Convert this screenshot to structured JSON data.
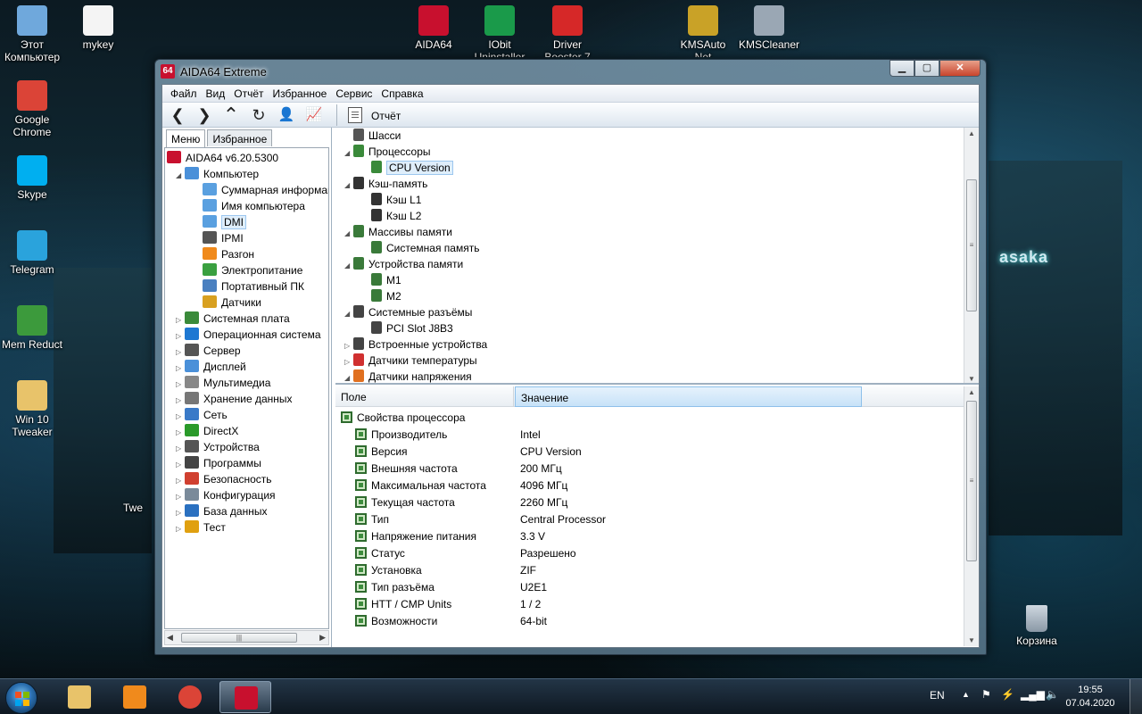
{
  "desktop": {
    "icons_left": [
      {
        "label": "Этот Компьютер",
        "icon": "computer-icon",
        "color": "#6fa8dc"
      },
      {
        "label": "mykey",
        "icon": "file-icon",
        "color": "#f4f4f4"
      },
      {
        "label": "Google Chrome",
        "icon": "chrome-icon",
        "color": "#db4437"
      },
      {
        "label": "Skype",
        "icon": "skype-icon",
        "color": "#00aff0"
      },
      {
        "label": "Telegram",
        "icon": "telegram-icon",
        "color": "#2aa3dc"
      },
      {
        "label": "Mem Reduct",
        "icon": "memreduct-icon",
        "color": "#3c9a3c"
      },
      {
        "label": "Win 10 Tweaker",
        "icon": "folder-icon",
        "color": "#e8c36a"
      }
    ],
    "icons_top": [
      {
        "label": "AIDA64",
        "icon": "aida64-icon",
        "color": "#c8102e"
      },
      {
        "label": "IObit Uninstaller",
        "icon": "iobit-icon",
        "color": "#1a9a4a"
      },
      {
        "label": "Driver Booster 7",
        "icon": "driverbooster-icon",
        "color": "#d62828"
      },
      {
        "label": "KMSAuto Net",
        "icon": "kmsauto-icon",
        "color": "#c9a227"
      },
      {
        "label": "KMSCleaner",
        "icon": "kmscleaner-icon",
        "color": "#9aa7b4"
      }
    ],
    "recycle_bin": {
      "label": "Корзина",
      "icon": "recycle-bin-icon"
    },
    "partial_label": "Twe",
    "sign_text": "asaka"
  },
  "window": {
    "title": "AIDA64 Extreme",
    "app_icon_text": "64",
    "buttons": {
      "minimize": "▁",
      "maximize": "▢",
      "close": "✕"
    },
    "menu": [
      "Файл",
      "Вид",
      "Отчёт",
      "Избранное",
      "Сервис",
      "Справка"
    ],
    "toolbar": {
      "back": "❮",
      "forward": "❯",
      "up": "⌃",
      "refresh": "↻",
      "user": "👤",
      "chart": "📈",
      "report_label": "Отчёт"
    },
    "tabs": [
      "Меню",
      "Избранное"
    ],
    "left_tree": [
      {
        "label": "AIDA64 v6.20.5300",
        "level": 0,
        "exp": "",
        "icon": "aida64-icon",
        "color": "#c8102e"
      },
      {
        "label": "Компьютер",
        "level": 1,
        "exp": "◢",
        "icon": "computer-icon",
        "color": "#4a90d9"
      },
      {
        "label": "Суммарная информация",
        "level": 2,
        "exp": "",
        "icon": "monitor-icon",
        "color": "#5aa0e0"
      },
      {
        "label": "Имя компьютера",
        "level": 2,
        "exp": "",
        "icon": "monitor-icon",
        "color": "#5aa0e0"
      },
      {
        "label": "DMI",
        "level": 2,
        "exp": "",
        "icon": "monitor-icon",
        "color": "#5aa0e0",
        "selected": true
      },
      {
        "label": "IPMI",
        "level": 2,
        "exp": "",
        "icon": "phone-icon",
        "color": "#555"
      },
      {
        "label": "Разгон",
        "level": 2,
        "exp": "",
        "icon": "flame-icon",
        "color": "#f08a1c"
      },
      {
        "label": "Электропитание",
        "level": 2,
        "exp": "",
        "icon": "battery-icon",
        "color": "#3aa040"
      },
      {
        "label": "Портативный ПК",
        "level": 2,
        "exp": "",
        "icon": "laptop-icon",
        "color": "#4a80c0"
      },
      {
        "label": "Датчики",
        "level": 2,
        "exp": "",
        "icon": "sensor-icon",
        "color": "#d8a020"
      },
      {
        "label": "Системная плата",
        "level": 1,
        "exp": "▷",
        "icon": "motherboard-icon",
        "color": "#3a8a3a"
      },
      {
        "label": "Операционная система",
        "level": 1,
        "exp": "▷",
        "icon": "windows-icon",
        "color": "#1e78d2"
      },
      {
        "label": "Сервер",
        "level": 1,
        "exp": "▷",
        "icon": "server-icon",
        "color": "#555"
      },
      {
        "label": "Дисплей",
        "level": 1,
        "exp": "▷",
        "icon": "display-icon",
        "color": "#4a90d9"
      },
      {
        "label": "Мультимедиа",
        "level": 1,
        "exp": "▷",
        "icon": "speaker-icon",
        "color": "#888"
      },
      {
        "label": "Хранение данных",
        "level": 1,
        "exp": "▷",
        "icon": "storage-icon",
        "color": "#777"
      },
      {
        "label": "Сеть",
        "level": 1,
        "exp": "▷",
        "icon": "network-icon",
        "color": "#3a7ac8"
      },
      {
        "label": "DirectX",
        "level": 1,
        "exp": "▷",
        "icon": "xbox-icon",
        "color": "#2a9a2a"
      },
      {
        "label": "Устройства",
        "level": 1,
        "exp": "▷",
        "icon": "device-icon",
        "color": "#555"
      },
      {
        "label": "Программы",
        "level": 1,
        "exp": "▷",
        "icon": "programs-icon",
        "color": "#444"
      },
      {
        "label": "Безопасность",
        "level": 1,
        "exp": "▷",
        "icon": "shield-icon",
        "color": "#d04030"
      },
      {
        "label": "Конфигурация",
        "level": 1,
        "exp": "▷",
        "icon": "config-icon",
        "color": "#7a8a9a"
      },
      {
        "label": "База данных",
        "level": 1,
        "exp": "▷",
        "icon": "database-icon",
        "color": "#2a70c0"
      },
      {
        "label": "Тест",
        "level": 1,
        "exp": "▷",
        "icon": "test-icon",
        "color": "#e0a010"
      }
    ],
    "right_tree": [
      {
        "label": "Шасси",
        "level": 1,
        "exp": "",
        "icon": "chassis-icon",
        "color": "#555"
      },
      {
        "label": "Процессоры",
        "level": 0,
        "exp": "◢",
        "icon": "cpu-icon",
        "color": "#3a8a3a"
      },
      {
        "label": "CPU Version",
        "level": 1,
        "exp": "",
        "icon": "cpu-icon",
        "color": "#3a8a3a",
        "selected": true
      },
      {
        "label": "Кэш-память",
        "level": 0,
        "exp": "◢",
        "icon": "cache-icon",
        "color": "#333"
      },
      {
        "label": "Кэш L1",
        "level": 1,
        "exp": "",
        "icon": "cache-icon",
        "color": "#333"
      },
      {
        "label": "Кэш L2",
        "level": 1,
        "exp": "",
        "icon": "cache-icon",
        "color": "#333"
      },
      {
        "label": "Массивы памяти",
        "level": 0,
        "exp": "◢",
        "icon": "memory-icon",
        "color": "#3a7a3a"
      },
      {
        "label": "Системная память",
        "level": 1,
        "exp": "",
        "icon": "memory-icon",
        "color": "#3a7a3a"
      },
      {
        "label": "Устройства памяти",
        "level": 0,
        "exp": "◢",
        "icon": "memory-icon",
        "color": "#3a7a3a"
      },
      {
        "label": "M1",
        "level": 1,
        "exp": "",
        "icon": "memory-icon",
        "color": "#3a7a3a"
      },
      {
        "label": "M2",
        "level": 1,
        "exp": "",
        "icon": "memory-icon",
        "color": "#3a7a3a"
      },
      {
        "label": "Системные разъёмы",
        "level": 0,
        "exp": "◢",
        "icon": "slot-icon",
        "color": "#444"
      },
      {
        "label": "PCI Slot J8B3",
        "level": 1,
        "exp": "",
        "icon": "slot-icon",
        "color": "#444"
      },
      {
        "label": "Встроенные устройства",
        "level": 0,
        "exp": "▷",
        "icon": "slot-icon",
        "color": "#444"
      },
      {
        "label": "Датчики температуры",
        "level": 0,
        "exp": "▷",
        "icon": "thermometer-icon",
        "color": "#d03030"
      },
      {
        "label": "Датчики напряжения",
        "level": 0,
        "exp": "◢",
        "icon": "voltage-icon",
        "color": "#e07020"
      }
    ],
    "grid": {
      "col_field": "Поле",
      "col_value": "Значение",
      "group": "Свойства процессора",
      "rows": [
        {
          "field": "Производитель",
          "value": "Intel"
        },
        {
          "field": "Версия",
          "value": "CPU Version"
        },
        {
          "field": "Внешняя частота",
          "value": "200 МГц"
        },
        {
          "field": "Максимальная частота",
          "value": "4096 МГц"
        },
        {
          "field": "Текущая частота",
          "value": "2260 МГц"
        },
        {
          "field": "Тип",
          "value": "Central Processor"
        },
        {
          "field": "Напряжение питания",
          "value": "3.3 V"
        },
        {
          "field": "Статус",
          "value": "Разрешено"
        },
        {
          "field": "Установка",
          "value": "ZIF"
        },
        {
          "field": "Тип разъёма",
          "value": "U2E1"
        },
        {
          "field": "HTT / CMP Units",
          "value": "1 / 2"
        },
        {
          "field": "Возможности",
          "value": "64-bit"
        }
      ]
    }
  },
  "taskbar": {
    "items": [
      {
        "name": "explorer",
        "icon": "explorer-icon",
        "color": "#e8c36a"
      },
      {
        "name": "media",
        "icon": "media-player-icon",
        "color": "#f08a1c"
      },
      {
        "name": "chrome",
        "icon": "chrome-icon",
        "color": "#db4437"
      },
      {
        "name": "aida64",
        "icon": "aida64-icon",
        "color": "#c8102e",
        "active": true
      }
    ],
    "lang": "EN",
    "time": "19:55",
    "date": "07.04.2020"
  }
}
